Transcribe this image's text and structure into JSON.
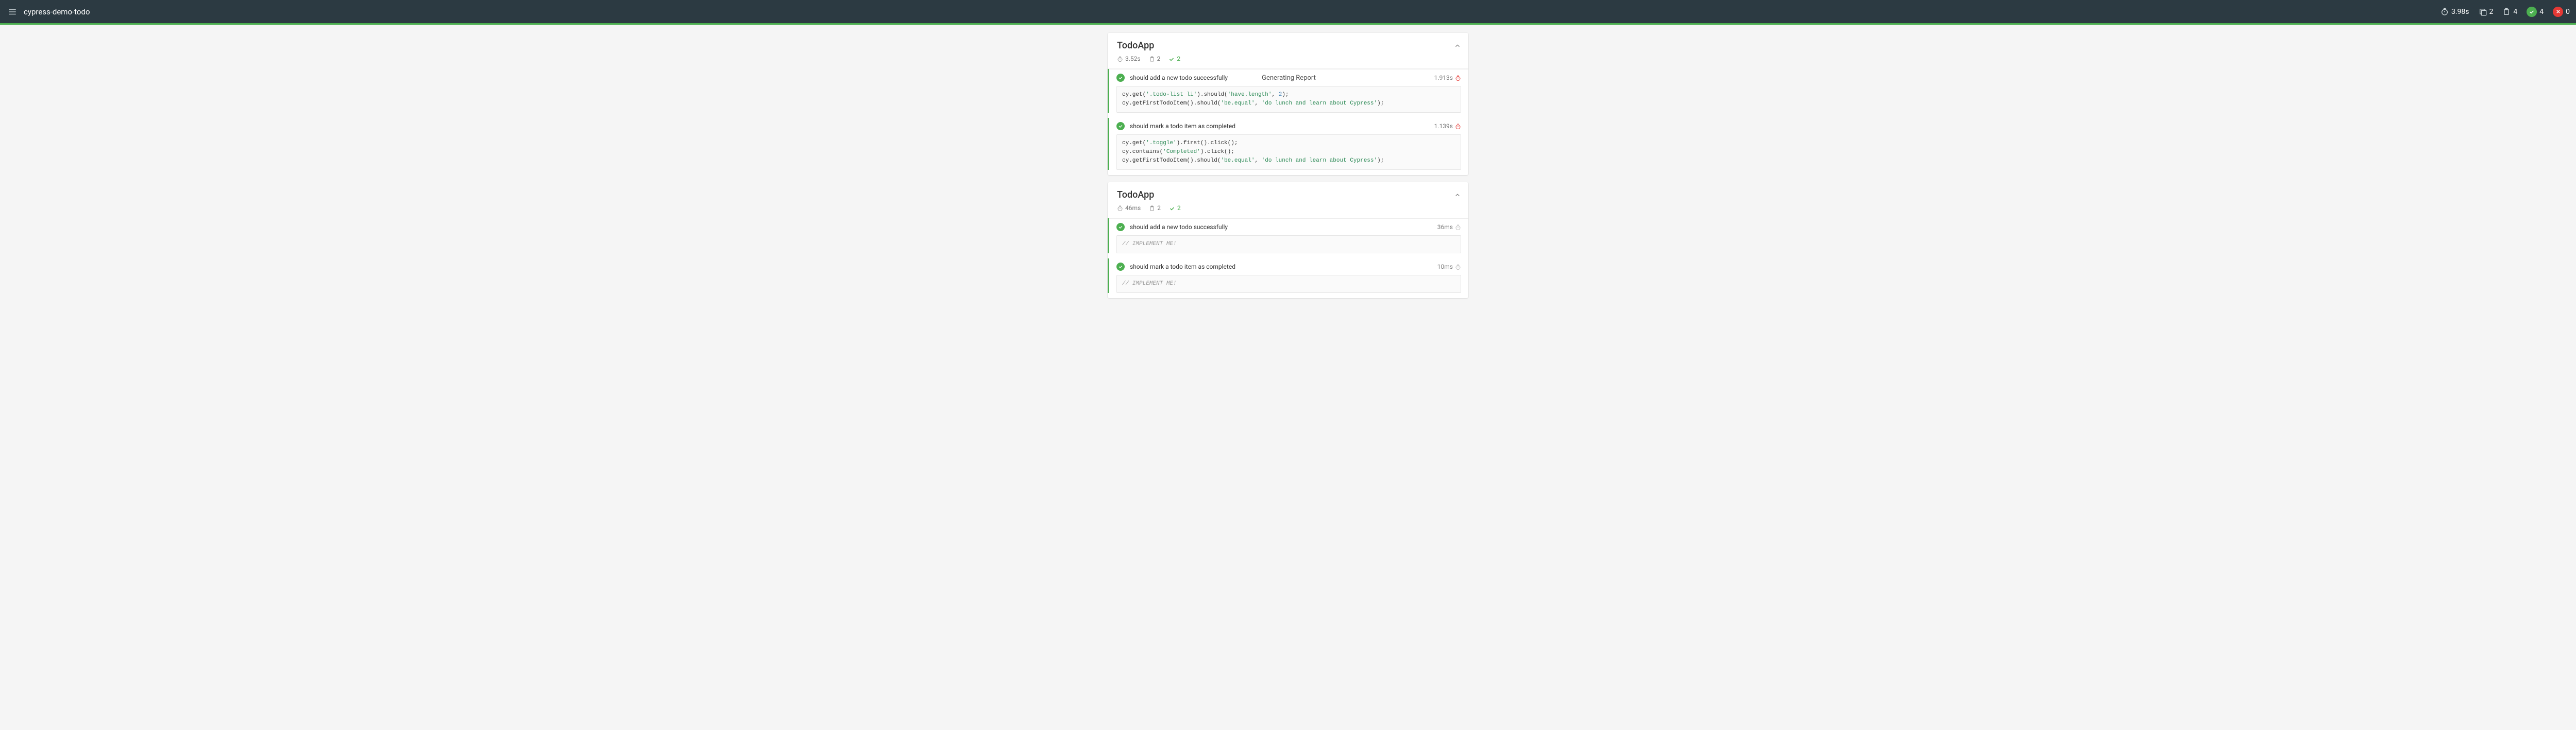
{
  "header": {
    "title": "cypress-demo-todo",
    "duration": "3.98s",
    "suites": "2",
    "tests": "4",
    "passes": "4",
    "failures": "0"
  },
  "center_message": "Generating Report",
  "suites": [
    {
      "title": "TodoApp",
      "duration": "3.52s",
      "tests_count": "2",
      "passes_count": "2",
      "tests": [
        {
          "name": "should add a new todo successfully",
          "duration": "1.913s",
          "speed": "slow",
          "center_overlay": true,
          "code_plain": "cy.get('.todo-list li').should('have.length', 2);\ncy.getFirstTodoItem().should('be.equal', 'do lunch and learn about Cypress');",
          "code_tokens": [
            {
              "t": "cy.get("
            },
            {
              "t": "'.todo-list li'",
              "c": "str"
            },
            {
              "t": ").should("
            },
            {
              "t": "'have.length'",
              "c": "str"
            },
            {
              "t": ", "
            },
            {
              "t": "2",
              "c": "num"
            },
            {
              "t": ");\n"
            },
            {
              "t": "cy.getFirstTodoItem().should("
            },
            {
              "t": "'be.equal'",
              "c": "str"
            },
            {
              "t": ", "
            },
            {
              "t": "'do lunch and learn about Cypress'",
              "c": "str"
            },
            {
              "t": ");"
            }
          ]
        },
        {
          "name": "should mark a todo item as completed",
          "duration": "1.139s",
          "speed": "slow",
          "code_plain": "cy.get('.toggle').first().click();\ncy.contains('Completed').click();\ncy.getFirstTodoItem().should('be.equal', 'do lunch and learn about Cypress');",
          "code_tokens": [
            {
              "t": "cy.get("
            },
            {
              "t": "'.toggle'",
              "c": "str"
            },
            {
              "t": ").first().click();\n"
            },
            {
              "t": "cy.contains("
            },
            {
              "t": "'Completed'",
              "c": "str"
            },
            {
              "t": ").click();\n"
            },
            {
              "t": "cy.getFirstTodoItem().should("
            },
            {
              "t": "'be.equal'",
              "c": "str"
            },
            {
              "t": ", "
            },
            {
              "t": "'do lunch and learn about Cypress'",
              "c": "str"
            },
            {
              "t": ");"
            }
          ]
        }
      ]
    },
    {
      "title": "TodoApp",
      "duration": "46ms",
      "tests_count": "2",
      "passes_count": "2",
      "tests": [
        {
          "name": "should add a new todo successfully",
          "duration": "36ms",
          "speed": "fast",
          "code_plain": "// IMPLEMENT ME!",
          "code_tokens": [
            {
              "t": "// IMPLEMENT ME!",
              "c": "cm"
            }
          ]
        },
        {
          "name": "should mark a todo item as completed",
          "duration": "10ms",
          "speed": "fast",
          "code_plain": "// IMPLEMENT ME!",
          "code_tokens": [
            {
              "t": "// IMPLEMENT ME!",
              "c": "cm"
            }
          ]
        }
      ]
    }
  ],
  "colors": {
    "header_bg": "#2c3a42",
    "accent_green": "#4caf50",
    "accent_red": "#e53935",
    "page_bg": "#f5f5f5"
  }
}
